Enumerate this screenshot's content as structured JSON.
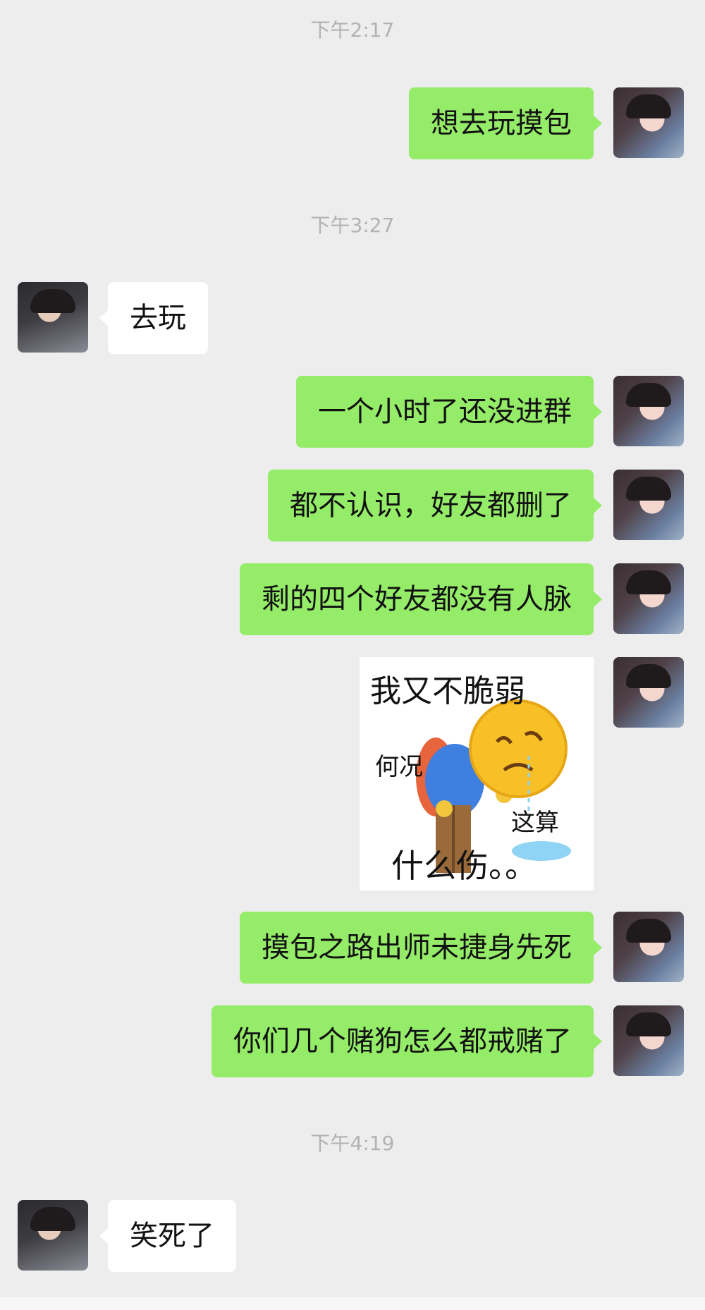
{
  "messages": {
    "t1": "下午2:17",
    "m1": "想去玩摸包",
    "t2": "下午3:27",
    "m2": "去玩",
    "m3": "一个小时了还没进群",
    "m4": "都不认识，好友都删了",
    "m5": "剩的四个好友都没有人脉",
    "sticker": {
      "line1": "我又不脆弱",
      "line2": "何况",
      "line3": "这算",
      "line4": "什么伤。。"
    },
    "m6": "摸包之路出师未捷身先死",
    "m7": "你们几个赌狗怎么都戒赌了",
    "t3": "下午4:19",
    "m8": "笑死了"
  },
  "colors": {
    "background": "#ededed",
    "self_bubble": "#95ec69",
    "other_bubble": "#ffffff",
    "timestamp": "#b2b2b2"
  }
}
